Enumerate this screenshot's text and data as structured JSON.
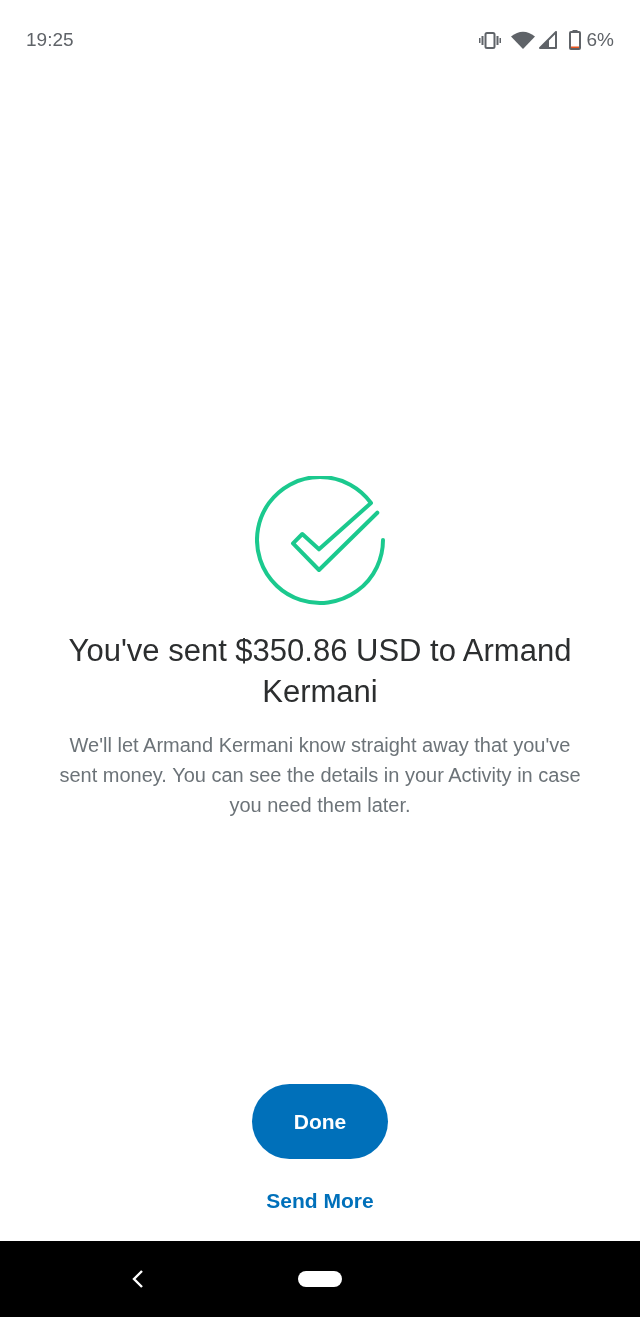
{
  "status_bar": {
    "time": "19:25",
    "battery": "6%"
  },
  "confirmation": {
    "title": "You've sent $350.86 USD to Armand Kermani",
    "message": "We'll let Armand Kermani know straight away that you've sent money. You can see the details in your Activity in case you need them later."
  },
  "actions": [
    {
      "kind": "primary",
      "label": "Done"
    },
    {
      "kind": "link",
      "label": "Send More"
    }
  ]
}
